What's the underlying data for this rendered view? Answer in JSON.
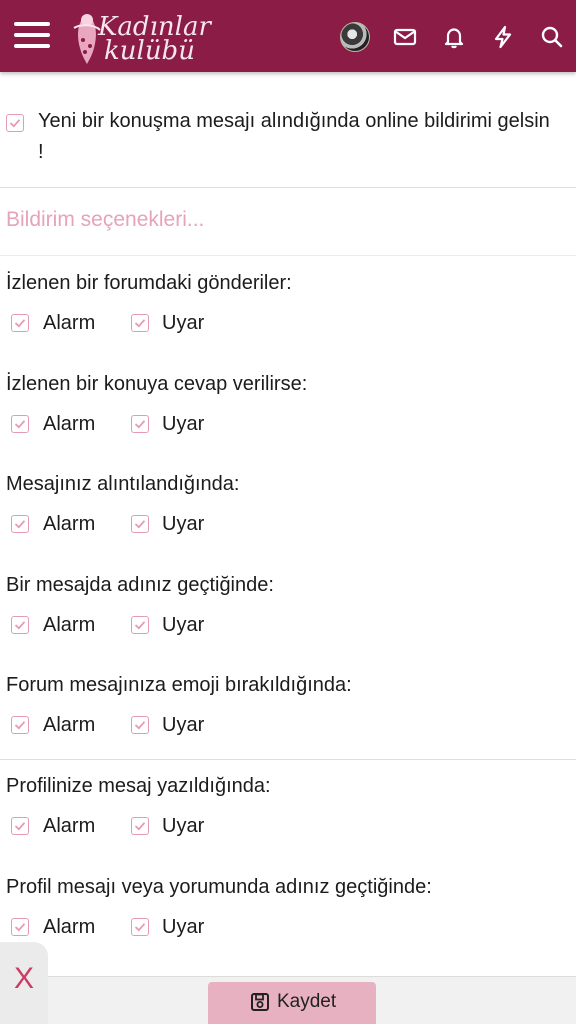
{
  "header": {
    "logo_line1": "Kadınlar",
    "logo_line2": "kulübü",
    "icons": [
      "menu-icon",
      "avatar",
      "envelope-icon",
      "bell-icon",
      "bolt-icon",
      "search-icon"
    ],
    "background": "#8b1c45"
  },
  "consent": {
    "checked": true,
    "label": "Yeni bir konuşma mesajı alındığında online bildirimi gelsin !"
  },
  "section_title": "Bildirim seçenekleri...",
  "groups": [
    {
      "label": "İzlenen bir forumdaki gönderiler:",
      "alarm": "Alarm",
      "uyar": "Uyar"
    },
    {
      "label": "İzlenen bir konuya cevap verilirse:",
      "alarm": "Alarm",
      "uyar": "Uyar"
    },
    {
      "label": "Mesajınız alıntılandığında:",
      "alarm": "Alarm",
      "uyar": "Uyar"
    },
    {
      "label": "Bir mesajda adınız geçtiğinde:",
      "alarm": "Alarm",
      "uyar": "Uyar"
    },
    {
      "label": "Forum mesajınıza emoji bırakıldığında:",
      "alarm": "Alarm",
      "uyar": "Uyar"
    },
    {
      "label": "Profilinize mesaj yazıldığında:",
      "alarm": "Alarm",
      "uyar": "Uyar"
    },
    {
      "label": "Profil mesajı veya yorumunda adınız geçtiğinde:",
      "alarm": "Alarm",
      "uyar": "Uyar"
    }
  ],
  "close_label": "X",
  "save_label": "Kaydet",
  "colors": {
    "accent": "#8b1c45",
    "checkbox": "#e59bb4",
    "section": "#e6a3b9",
    "save": "#e8b1c2"
  }
}
